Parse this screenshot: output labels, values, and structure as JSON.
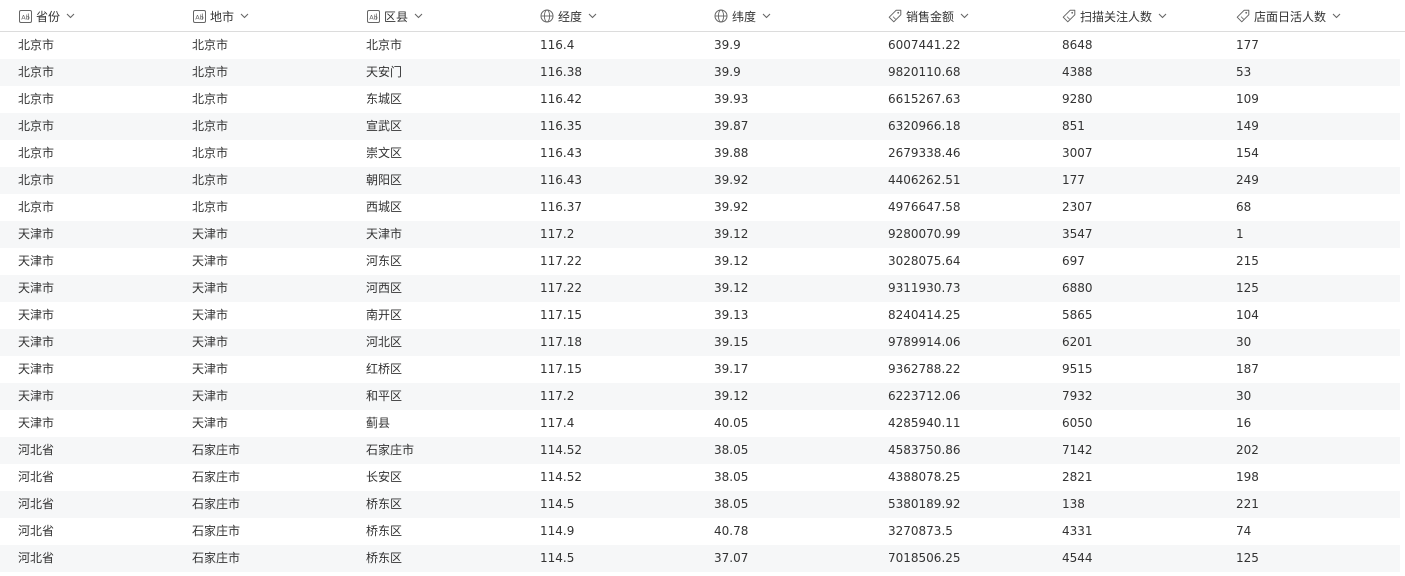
{
  "columns": [
    {
      "label": "省份",
      "type": "text-type-icon"
    },
    {
      "label": "地市",
      "type": "text-type-icon"
    },
    {
      "label": "区县",
      "type": "text-type-icon"
    },
    {
      "label": "经度",
      "type": "globe-icon"
    },
    {
      "label": "纬度",
      "type": "globe-icon"
    },
    {
      "label": "销售金额",
      "type": "number-tag-icon"
    },
    {
      "label": "扫描关注人数",
      "type": "number-tag-icon"
    },
    {
      "label": "店面日活人数",
      "type": "number-tag-icon"
    }
  ],
  "rows": [
    [
      "北京市",
      "北京市",
      "北京市",
      "116.4",
      "39.9",
      "6007441.22",
      "8648",
      "177"
    ],
    [
      "北京市",
      "北京市",
      "天安门",
      "116.38",
      "39.9",
      "9820110.68",
      "4388",
      "53"
    ],
    [
      "北京市",
      "北京市",
      "东城区",
      "116.42",
      "39.93",
      "6615267.63",
      "9280",
      "109"
    ],
    [
      "北京市",
      "北京市",
      "宣武区",
      "116.35",
      "39.87",
      "6320966.18",
      "851",
      "149"
    ],
    [
      "北京市",
      "北京市",
      "崇文区",
      "116.43",
      "39.88",
      "2679338.46",
      "3007",
      "154"
    ],
    [
      "北京市",
      "北京市",
      "朝阳区",
      "116.43",
      "39.92",
      "4406262.51",
      "177",
      "249"
    ],
    [
      "北京市",
      "北京市",
      "西城区",
      "116.37",
      "39.92",
      "4976647.58",
      "2307",
      "68"
    ],
    [
      "天津市",
      "天津市",
      "天津市",
      "117.2",
      "39.12",
      "9280070.99",
      "3547",
      "1"
    ],
    [
      "天津市",
      "天津市",
      "河东区",
      "117.22",
      "39.12",
      "3028075.64",
      "697",
      "215"
    ],
    [
      "天津市",
      "天津市",
      "河西区",
      "117.22",
      "39.12",
      "9311930.73",
      "6880",
      "125"
    ],
    [
      "天津市",
      "天津市",
      "南开区",
      "117.15",
      "39.13",
      "8240414.25",
      "5865",
      "104"
    ],
    [
      "天津市",
      "天津市",
      "河北区",
      "117.18",
      "39.15",
      "9789914.06",
      "6201",
      "30"
    ],
    [
      "天津市",
      "天津市",
      "红桥区",
      "117.15",
      "39.17",
      "9362788.22",
      "9515",
      "187"
    ],
    [
      "天津市",
      "天津市",
      "和平区",
      "117.2",
      "39.12",
      "6223712.06",
      "7932",
      "30"
    ],
    [
      "天津市",
      "天津市",
      "蓟县",
      "117.4",
      "40.05",
      "4285940.11",
      "6050",
      "16"
    ],
    [
      "河北省",
      "石家庄市",
      "石家庄市",
      "114.52",
      "38.05",
      "4583750.86",
      "7142",
      "202"
    ],
    [
      "河北省",
      "石家庄市",
      "长安区",
      "114.52",
      "38.05",
      "4388078.25",
      "2821",
      "198"
    ],
    [
      "河北省",
      "石家庄市",
      "桥东区",
      "114.5",
      "38.05",
      "5380189.92",
      "138",
      "221"
    ],
    [
      "河北省",
      "石家庄市",
      "桥东区",
      "114.9",
      "40.78",
      "3270873.5",
      "4331",
      "74"
    ],
    [
      "河北省",
      "石家庄市",
      "桥东区",
      "114.5",
      "37.07",
      "7018506.25",
      "4544",
      "125"
    ]
  ],
  "colors": {
    "header_border": "#dcdcdc",
    "row_alt_bg": "#f6f7f8",
    "text": "#333333",
    "icon": "#666666"
  }
}
